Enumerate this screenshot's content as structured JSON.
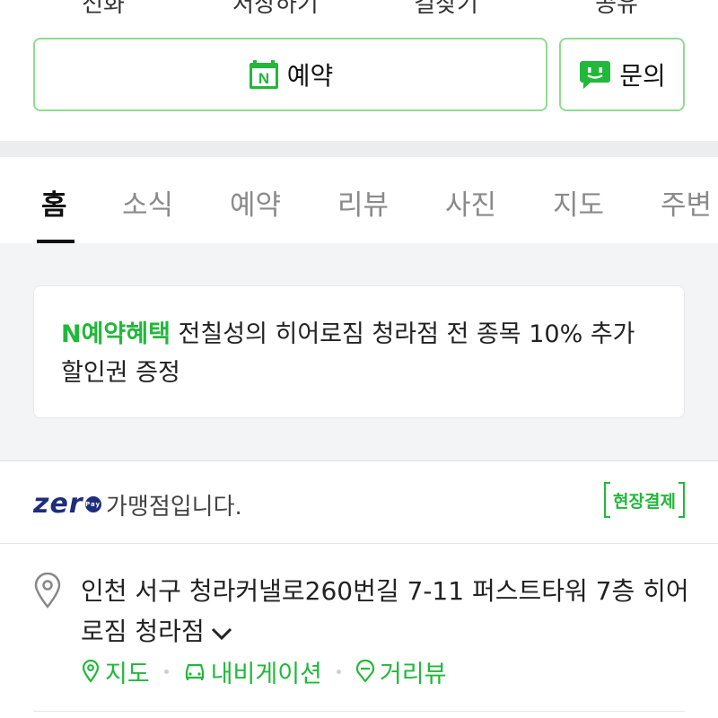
{
  "top_actions": [
    "전화",
    "저장하기",
    "길찾기",
    "공유"
  ],
  "buttons": {
    "reserve_label": "예약",
    "inquiry_label": "문의"
  },
  "tabs": [
    "홈",
    "소식",
    "예약",
    "리뷰",
    "사진",
    "지도",
    "주변"
  ],
  "active_tab": "홈",
  "benefit": {
    "highlight": "N예약혜택",
    "text": " 전칠성의 히어로짐 청라점 전 종목 10% 추가 할인권 증정"
  },
  "zeropay": {
    "logo": "zer",
    "pay_mark": "Pay",
    "text": "가맹점입니다.",
    "badge": "현장결제"
  },
  "address": {
    "line": "인천 서구 청라커낼로260번길 7-11 퍼스트타워 7층 히어로짐 청라점"
  },
  "links": {
    "map": "지도",
    "navigation": "내비게이션",
    "street_view": "거리뷰"
  },
  "colors": {
    "accent_green": "#22b83a",
    "border_green": "#8fdc8f",
    "zero_navy": "#1f2d7d"
  }
}
